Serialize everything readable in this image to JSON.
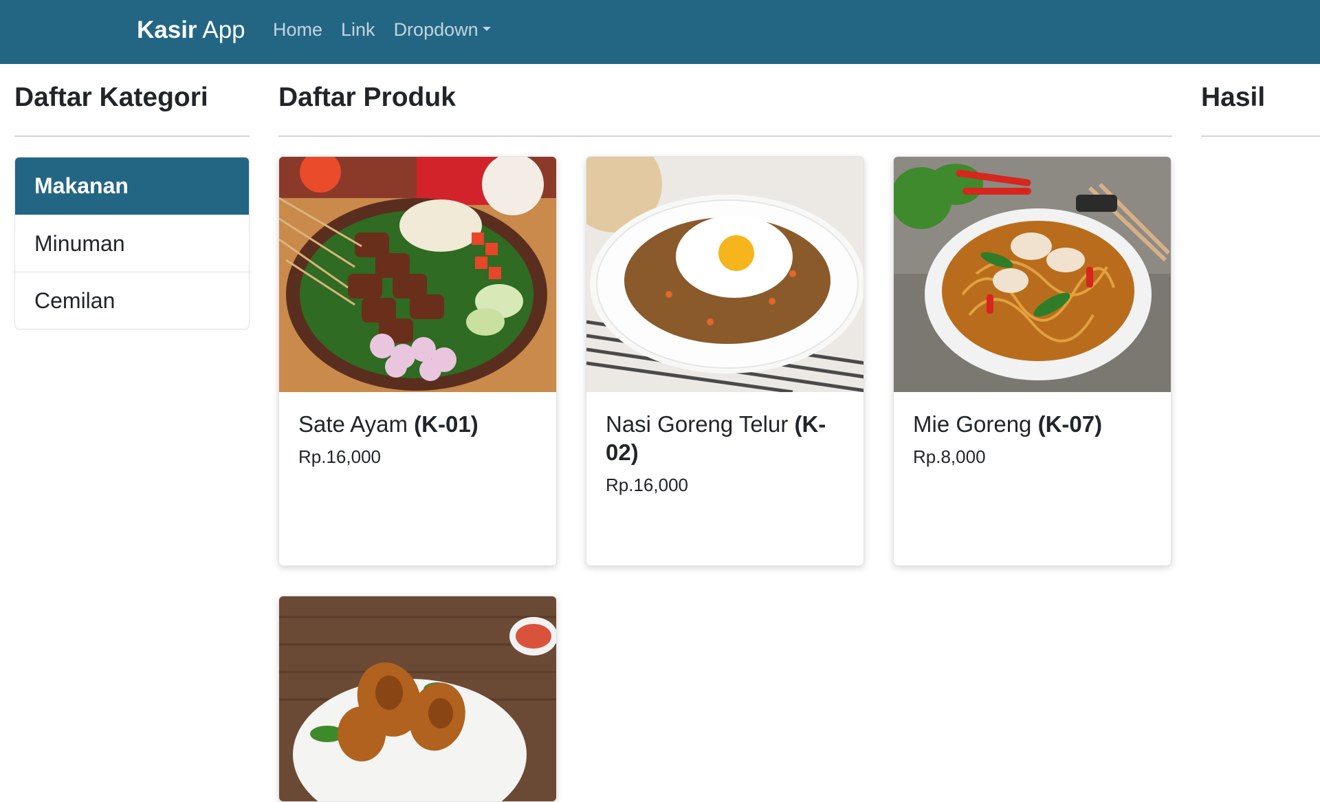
{
  "navbar": {
    "brand_bold": "Kasir",
    "brand_rest": " App",
    "links": [
      "Home",
      "Link",
      "Dropdown"
    ]
  },
  "columns": {
    "categories_title": "Daftar Kategori",
    "products_title": "Daftar Produk",
    "result_title": "Hasil"
  },
  "categories": [
    "Makanan",
    "Minuman",
    "Cemilan"
  ],
  "active_category": "Makanan",
  "products": [
    {
      "name": "Sate Ayam",
      "code": "(K-01)",
      "price": "Rp.16,000",
      "image_icon": "sate-ayam-photo"
    },
    {
      "name": "Nasi Goreng Telur",
      "code": "(K-02)",
      "price": "Rp.16,000",
      "image_icon": "nasi-goreng-photo"
    },
    {
      "name": "Mie Goreng",
      "code": "(K-07)",
      "price": "Rp.8,000",
      "image_icon": "mie-goreng-photo"
    },
    {
      "name": "",
      "code": "",
      "price": "",
      "image_icon": "ayam-goreng-photo"
    }
  ],
  "colors": {
    "primary": "#236684",
    "text": "#212529"
  }
}
